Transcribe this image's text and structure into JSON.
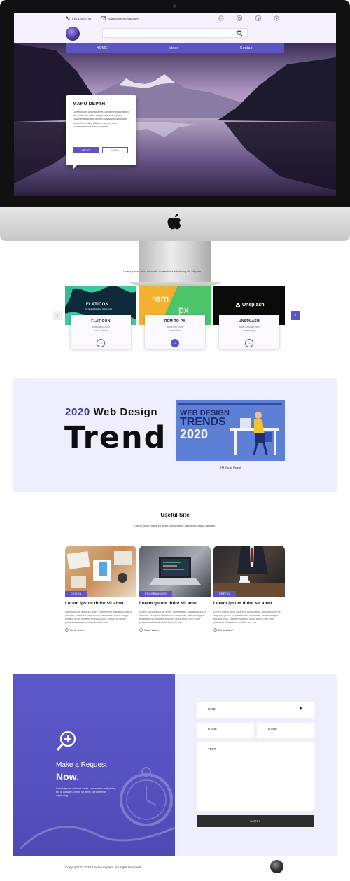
{
  "topbar": {
    "phone": "010-3394-5793",
    "email": "maruboi999@gmail.com"
  },
  "nav": {
    "items": [
      "HOME",
      "Video",
      "Contact"
    ]
  },
  "hero_card": {
    "title": "MARU DEPTH",
    "text": "Lorem ipsum dolor sit amet, consectetur adipiscing elit. Justo non enim, neque sem luctus porta. Quam felis egestas viverra massa purus posuere elementum tellus. Ultrices viverra purus condimentum sit diam dolor elit.",
    "btn_about": "ABOUT",
    "btn_video": "VIDEO"
  },
  "sites": {
    "subtitle": "Lorem ipsum dolor sit amet, consectetur adipiscing elit aliquam.",
    "prev": "‹",
    "next": "›",
    "items": [
      {
        "thumb_text": "FLATICON",
        "thumb_sub": "The largest database of free icons",
        "title": "FLATICON",
        "line1": "www.flaticon.com",
        "line2": "Icon & Vector",
        "go": "→"
      },
      {
        "thumb_text": "rem",
        "thumb_text2": "px",
        "title": "REM TO PX",
        "line1": "www.rem to px",
        "line2": "rem Value",
        "go": "→"
      },
      {
        "thumb_text": "Unsplash",
        "title": "UNSPLASH",
        "line1": "www.unsplash.com",
        "line2": "Free image",
        "go": "→"
      }
    ]
  },
  "trend": {
    "year": "2020",
    "heading": "Web Design",
    "big": "Trend",
    "video_line1": "WEB DESIGN",
    "video_line2": "TRENDS",
    "video_line3": "2020",
    "link": "Go to Video!"
  },
  "useful": {
    "title": "Useful Site",
    "subtitle": "Lorem ipsum dolor sit amet, consectetur adipiscing elit ut aliquam.",
    "cards": [
      {
        "tag": "DESIGN",
        "title": "Lorem ipsum dolor sit amet",
        "text": "Lorem ipsum dolor sit amet, consectetur adipiscing elit ut aliquam, purus sit amet luctus venenatis, lectus magna fringilla urna, porttitor rhoncus dolor purus non enim praesent elementum facilisis leo, vel",
        "link": "Go to video!"
      },
      {
        "tag": "PROGRAMMING",
        "title": "Lorem ipsum dolor sit amet",
        "text": "Lorem ipsum dolor sit amet, consectetur adipiscing elit ut aliquam, purus sit amet luctus venenatis, lectus magna fringilla urna, porttitor rhoncus dolor purus non enim praesent elementum facilisis leo, vel",
        "link": "Go to Video!"
      },
      {
        "tag": "USEFUL",
        "title": "Lorem ipsum dolor sit amet",
        "text": "Lorem ipsum dolor sit amet, consectetur adipiscing elit ut aliquam, purus sit amet luctus venenatis, lectus magna fringilla urna, porttitor rhoncus dolor purus non enim praesent elementum facilisis leo, vel",
        "link": "Go to Video!"
      }
    ]
  },
  "request": {
    "line1": "Make a Request",
    "line2": "Now.",
    "text": "Lorem ipsum dolor sit amet, consectetur adipiscing elit ut aliquam, purus sit amet, consectetur adipiscing.",
    "kind": "KIND",
    "caret": "▼",
    "name1": "NAME",
    "name2": "NAME",
    "textarea": "TEXT",
    "button": "BATTEN"
  },
  "footer": {
    "copyright": "Copyright © 2020 LeeSeungyeol. All right reserved."
  },
  "colors": {
    "accent": "#5d54c4",
    "lavender_bg": "#eeeefc",
    "dark_button": "#2e2e2e"
  }
}
